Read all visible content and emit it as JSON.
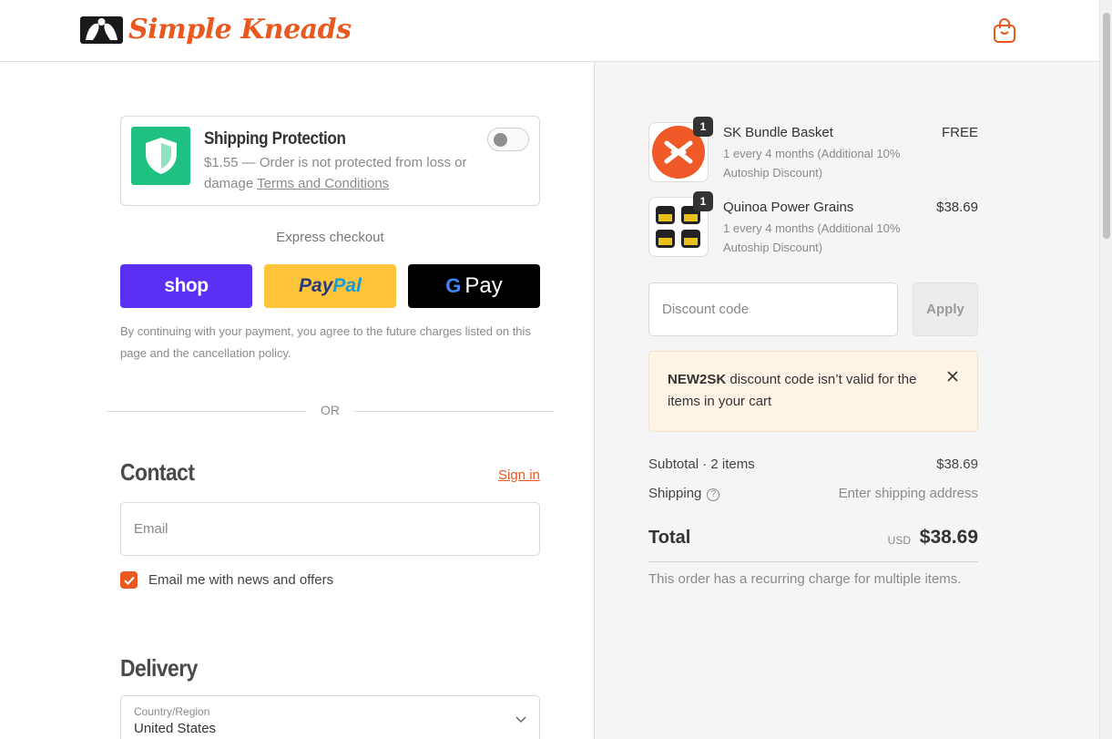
{
  "header": {
    "brand": "Simple Kneads",
    "cart_icon": "shopping-bag-icon"
  },
  "protection": {
    "title": "Shipping Protection",
    "desc_prefix": "$1.55 — Order is not protected from loss or damage ",
    "terms_link": "Terms and Conditions",
    "toggle_on": false
  },
  "express": {
    "label": "Express checkout",
    "shop_label": "shop",
    "paypal_a": "Pay",
    "paypal_b": "Pal",
    "gpay_g": "G",
    "gpay_label": "Pay",
    "consent": "By continuing with your payment, you agree to the future charges listed on this page and the cancellation policy."
  },
  "or_label": "OR",
  "contact": {
    "title": "Contact",
    "signin": "Sign in",
    "email_placeholder": "Email",
    "news_label": "Email me with news and offers",
    "news_checked": true
  },
  "delivery": {
    "title": "Delivery",
    "country_label": "Country/Region",
    "country_value": "United States"
  },
  "items": [
    {
      "name": "SK Bundle Basket",
      "sub": "1 every 4 months (Additional 10% Autoship Discount)",
      "price": "FREE",
      "qty": "1"
    },
    {
      "name": "Quinoa Power Grains",
      "sub": "1 every 4 months (Additional 10% Autoship Discount)",
      "price": "$38.69",
      "qty": "1"
    }
  ],
  "discount": {
    "placeholder": "Discount code",
    "apply": "Apply",
    "error_code": "NEW2SK",
    "error_msg": " discount code isn’t valid for the items in your cart"
  },
  "summary": {
    "subtotal_label": "Subtotal · 2 items",
    "subtotal_value": "$38.69",
    "shipping_label": "Shipping",
    "shipping_value": "Enter shipping address",
    "total_label": "Total",
    "currency": "USD",
    "total_value": "$38.69",
    "recurring": "This order has a recurring charge for multiple items."
  },
  "colors": {
    "accent": "#e8581f",
    "shop": "#5a31f4",
    "paypal": "#ffc439",
    "shield": "#1fc180"
  }
}
